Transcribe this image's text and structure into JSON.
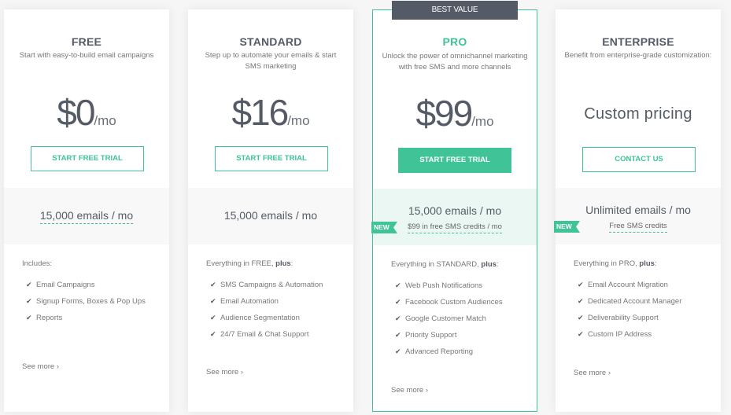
{
  "badge": "BEST VALUE",
  "plans": [
    {
      "name": "FREE",
      "description": "Start with easy-to-build email campaigns",
      "price": "$0",
      "per": "/mo",
      "cta": "START FREE TRIAL",
      "quota": "15,000 emails / mo",
      "features_intro": "Includes:",
      "features": [
        "Email Campaigns",
        "Signup Forms, Boxes & Pop Ups",
        "Reports"
      ],
      "see_more": "See more ›"
    },
    {
      "name": "STANDARD",
      "description": "Step up to automate your emails & start SMS marketing",
      "price": "$16",
      "per": "/mo",
      "cta": "START FREE TRIAL",
      "quota": "15,000 emails / mo",
      "features_intro_prefix": "Everything in FREE, ",
      "features_intro_bold": "plus",
      "features_intro_suffix": ":",
      "features": [
        "SMS Campaigns & Automation",
        "Email Automation",
        "Audience Segmentation",
        "24/7 Email & Chat Support"
      ],
      "see_more": "See more ›"
    },
    {
      "name": "PRO",
      "description": "Unlock the power of omnichannel marketing with free SMS and more channels",
      "price": "$99",
      "per": "/mo",
      "cta": "START FREE TRIAL",
      "quota": "15,000 emails / mo",
      "new_label": "NEW",
      "quota_sub": "$99 in free SMS credits / mo",
      "features_intro_prefix": "Everything in STANDARD, ",
      "features_intro_bold": "plus",
      "features_intro_suffix": ":",
      "features": [
        "Web Push Notifications",
        "Facebook Custom Audiences",
        "Google Customer Match",
        "Priority Support",
        "Advanced Reporting"
      ],
      "see_more": "See more ›"
    },
    {
      "name": "ENTERPRISE",
      "description": "Benefit from enterprise-grade customization:",
      "price_text": "Custom pricing",
      "cta": "CONTACT US",
      "quota": "Unlimited emails / mo",
      "new_label": "NEW",
      "quota_sub": "Free SMS credits",
      "features_intro_prefix": "Everything in PRO, ",
      "features_intro_bold": "plus",
      "features_intro_suffix": ":",
      "features": [
        "Email Account Migration",
        "Dedicated Account Manager",
        "Deliverability Support",
        "Custom IP Address"
      ],
      "see_more": "See more ›"
    }
  ],
  "icons": {
    "check": "✔"
  },
  "colors": {
    "accent": "#40c397",
    "dark": "#555b66",
    "highlight_bg": "#ebf7f2"
  }
}
